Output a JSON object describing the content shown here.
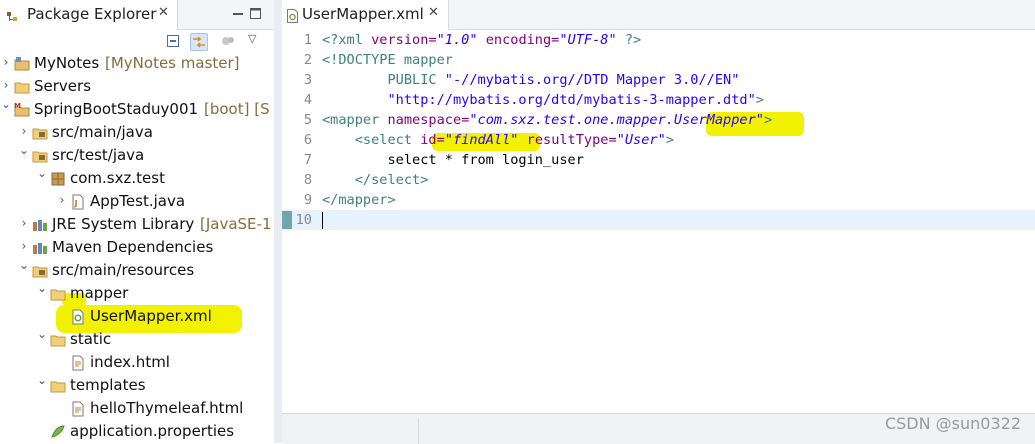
{
  "package_explorer": {
    "tab_title": "Package Explorer",
    "close_glyph": "✕",
    "tree": [
      {
        "label": "MyNotes",
        "decoration": "[MyNotes master]",
        "expanded": false,
        "icon": "project-icon"
      },
      {
        "label": "Servers",
        "decoration": "",
        "expanded": false,
        "icon": "folder-icon"
      },
      {
        "label": "SpringBootStaduy001",
        "decoration": "[boot] [S",
        "expanded": true,
        "icon": "maven-project-icon"
      },
      {
        "label": "src/main/java",
        "decoration": "",
        "expanded": false,
        "icon": "source-folder-icon"
      },
      {
        "label": "src/test/java",
        "decoration": "",
        "expanded": true,
        "icon": "source-folder-icon"
      },
      {
        "label": "com.sxz.test",
        "decoration": "",
        "expanded": true,
        "icon": "package-icon"
      },
      {
        "label": "AppTest.java",
        "decoration": "",
        "expanded": false,
        "icon": "java-file-icon"
      },
      {
        "label": "JRE System Library",
        "decoration": "[JavaSE-1",
        "expanded": false,
        "icon": "library-icon"
      },
      {
        "label": "Maven Dependencies",
        "decoration": "",
        "expanded": false,
        "icon": "library-icon"
      },
      {
        "label": "src/main/resources",
        "decoration": "",
        "expanded": true,
        "icon": "source-folder-icon"
      },
      {
        "label": "mapper",
        "decoration": "",
        "expanded": true,
        "icon": "folder-icon"
      },
      {
        "label": "UserMapper.xml",
        "decoration": "",
        "expanded": false,
        "icon": "xml-file-icon"
      },
      {
        "label": "static",
        "decoration": "",
        "expanded": true,
        "icon": "folder-icon"
      },
      {
        "label": "index.html",
        "decoration": "",
        "expanded": false,
        "icon": "html-file-icon"
      },
      {
        "label": "templates",
        "decoration": "",
        "expanded": true,
        "icon": "folder-icon"
      },
      {
        "label": "helloThymeleaf.html",
        "decoration": "",
        "expanded": false,
        "icon": "html-file-icon"
      },
      {
        "label": "application.properties",
        "decoration": "",
        "expanded": false,
        "icon": "properties-file-icon"
      }
    ]
  },
  "editor": {
    "tab_title": "UserMapper.xml",
    "close_glyph": "✕",
    "line_numbers": [
      "1",
      "2",
      "3",
      "4",
      "5",
      "6",
      "7",
      "8",
      "9",
      "10"
    ],
    "lines": [
      [
        {
          "t": "<?xml ",
          "c": "t-tag"
        },
        {
          "t": "version=",
          "c": "t-attr"
        },
        {
          "t": "\"1.0\"",
          "c": "t-val"
        },
        {
          "t": " ",
          "c": "t-plain"
        },
        {
          "t": "encoding=",
          "c": "t-attr"
        },
        {
          "t": "\"UTF-8\"",
          "c": "t-val"
        },
        {
          "t": " ?>",
          "c": "t-tag"
        }
      ],
      [
        {
          "t": "<!DOCTYPE mapper",
          "c": "t-tag"
        }
      ],
      [
        {
          "t": "        PUBLIC ",
          "c": "t-tag"
        },
        {
          "t": "\"-//mybatis.org//DTD Mapper 3.0//EN\"",
          "c": "t-str"
        }
      ],
      [
        {
          "t": "        ",
          "c": "t-plain"
        },
        {
          "t": "\"http://mybatis.org/dtd/mybatis-3-mapper.dtd\"",
          "c": "t-str"
        },
        {
          "t": ">",
          "c": "t-tag"
        }
      ],
      [
        {
          "t": "<mapper ",
          "c": "t-tag"
        },
        {
          "t": "namespace=",
          "c": "t-attr"
        },
        {
          "t": "\"com.sxz.test.one.mapper.UserMapper\"",
          "c": "t-val"
        },
        {
          "t": ">",
          "c": "t-tag"
        }
      ],
      [
        {
          "t": "    <select ",
          "c": "t-tag"
        },
        {
          "t": "id=",
          "c": "t-attr"
        },
        {
          "t": "\"findAll\"",
          "c": "t-val"
        },
        {
          "t": " ",
          "c": "t-plain"
        },
        {
          "t": "resultType=",
          "c": "t-attr"
        },
        {
          "t": "\"User\"",
          "c": "t-val"
        },
        {
          "t": ">",
          "c": "t-tag"
        }
      ],
      [
        {
          "t": "        select * from login_user",
          "c": "t-plain"
        }
      ],
      [
        {
          "t": "    </select>",
          "c": "t-tag"
        }
      ],
      [
        {
          "t": "</mapper>",
          "c": "t-tag"
        }
      ],
      [
        {
          "t": "",
          "c": "t-plain"
        }
      ]
    ]
  },
  "watermark": "CSDN @sun0322"
}
